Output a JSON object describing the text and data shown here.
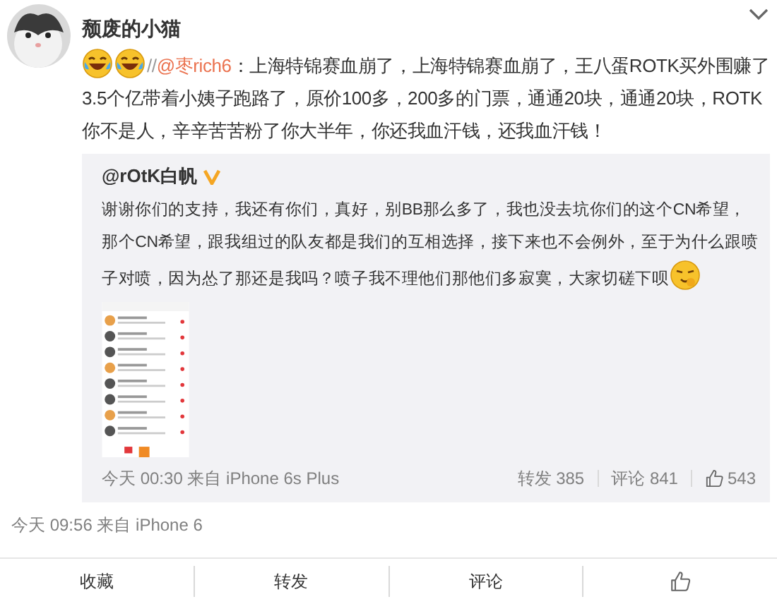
{
  "post": {
    "author": "颓废的小猫",
    "emojis": [
      {
        "kind": "laugh-cry"
      },
      {
        "kind": "laugh-cry"
      }
    ],
    "prefix": "//",
    "mention": "@枣rich6",
    "text": "：上海特锦赛血崩了，上海特锦赛血崩了，王八蛋ROTK买外围赚了3.5个亿带着小姨子跑路了，原价100多，200多的门票，通通20块，通通20块，ROTK你不是人，辛辛苦苦粉了你大半年，你还我血汗钱，还我血汗钱！",
    "repost": {
      "author": "@rOtK白帆",
      "verified": true,
      "text": "谢谢你们的支持，我还有你们，真好，别BB那么多了，我也没去坑你们的这个CN希望，那个CN希望，跟我组过的队友都是我们的互相选择，接下来也不会例外，至于为什么跟喷子对喷，因为怂了那还是我吗？喷子我不理他们那他们多寂寞，大家切磋下呗",
      "trailing_emoji": {
        "kind": "smirk"
      },
      "time": "今天 00:30 来自 iPhone 6s Plus",
      "stats": [
        {
          "kind": "text",
          "label": "转发 385"
        },
        {
          "kind": "text",
          "label": "评论 841"
        },
        {
          "kind": "like",
          "label": "543"
        }
      ]
    },
    "time": "今天 09:56 来自 iPhone 6",
    "actions": [
      {
        "kind": "text",
        "label": "收藏"
      },
      {
        "kind": "text",
        "label": "转发"
      },
      {
        "kind": "text",
        "label": "评论"
      },
      {
        "kind": "like"
      }
    ]
  }
}
